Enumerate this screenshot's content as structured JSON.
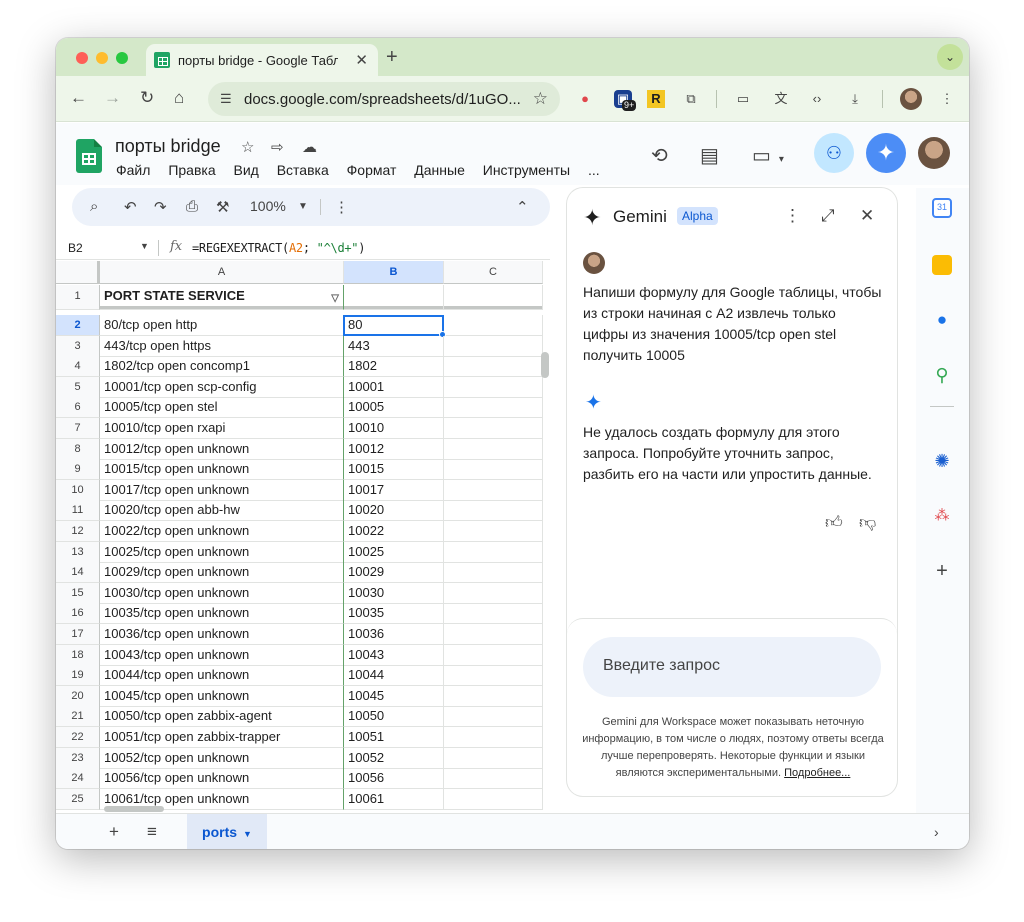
{
  "browser": {
    "tab_title": "порты bridge - Google Табли",
    "tab_close": "✕",
    "new_tab": "+",
    "url": "docs.google.com/spreadsheets/d/1uGO...",
    "ext_badge": "9+",
    "ext_r": "R"
  },
  "sheets": {
    "doc_title": "порты bridge",
    "menu": [
      "Файл",
      "Правка",
      "Вид",
      "Вставка",
      "Формат",
      "Данные",
      "Инструменты",
      "..."
    ],
    "zoom": "100%",
    "name_box": "B2",
    "formula_prefix": "=REGEXEXTRACT(",
    "formula_ref": "A2",
    "formula_sep": "; ",
    "formula_str": "\"^\\d+\"",
    "formula_suffix": ")",
    "columns": [
      "A",
      "B",
      "C"
    ],
    "header_row": {
      "num": "1",
      "a": "PORT STATE SERVICE",
      "b": "",
      "c": ""
    },
    "rows": [
      {
        "num": "2",
        "a": "80/tcp open http",
        "b": "80"
      },
      {
        "num": "3",
        "a": "443/tcp open https",
        "b": "443"
      },
      {
        "num": "4",
        "a": "1802/tcp open concomp1",
        "b": "1802"
      },
      {
        "num": "5",
        "a": "10001/tcp open scp-config",
        "b": "10001"
      },
      {
        "num": "6",
        "a": "10005/tcp open stel",
        "b": "10005"
      },
      {
        "num": "7",
        "a": "10010/tcp open rxapi",
        "b": "10010"
      },
      {
        "num": "8",
        "a": "10012/tcp open unknown",
        "b": "10012"
      },
      {
        "num": "9",
        "a": "10015/tcp open unknown",
        "b": "10015"
      },
      {
        "num": "10",
        "a": "10017/tcp open unknown",
        "b": "10017"
      },
      {
        "num": "11",
        "a": "10020/tcp open abb-hw",
        "b": "10020"
      },
      {
        "num": "12",
        "a": "10022/tcp open unknown",
        "b": "10022"
      },
      {
        "num": "13",
        "a": "10025/tcp open unknown",
        "b": "10025"
      },
      {
        "num": "14",
        "a": "10029/tcp open unknown",
        "b": "10029"
      },
      {
        "num": "15",
        "a": "10030/tcp open unknown",
        "b": "10030"
      },
      {
        "num": "16",
        "a": "10035/tcp open unknown",
        "b": "10035"
      },
      {
        "num": "17",
        "a": "10036/tcp open unknown",
        "b": "10036"
      },
      {
        "num": "18",
        "a": "10043/tcp open unknown",
        "b": "10043"
      },
      {
        "num": "19",
        "a": "10044/tcp open unknown",
        "b": "10044"
      },
      {
        "num": "20",
        "a": "10045/tcp open unknown",
        "b": "10045"
      },
      {
        "num": "21",
        "a": "10050/tcp open zabbix-agent",
        "b": "10050"
      },
      {
        "num": "22",
        "a": "10051/tcp open zabbix-trapper",
        "b": "10051"
      },
      {
        "num": "23",
        "a": "10052/tcp open unknown",
        "b": "10052"
      },
      {
        "num": "24",
        "a": "10056/tcp open unknown",
        "b": "10056"
      },
      {
        "num": "25",
        "a": "10061/tcp open unknown",
        "b": "10061"
      }
    ],
    "sheet_tab": "ports"
  },
  "gemini": {
    "title": "Gemini",
    "badge": "Alpha",
    "user_message": "Напиши формулу для Google таблицы, чтобы из строки начиная с A2 извлечь только цифры  из значения 10005/tcp open stel получить 10005",
    "bot_message": "Не удалось создать формулу для этого запроса. Попробуйте уточнить запрос, разбить его на части или упростить данные.",
    "input_placeholder": "Введите запрос",
    "disclaimer": "Gemini для Workspace может показывать неточную информацию, в том числе о людях, поэтому ответы всегда лучше перепроверять. Некоторые функции и языки являются экспериментальными.",
    "disclaimer_link": "Подробнее..."
  },
  "colors": {
    "tab_strip": "#d4e8c9",
    "accent_blue": "#1a73e8",
    "sheets_green": "#1fa463",
    "selection_blue": "#d3e3fd"
  },
  "icons": [
    "back-icon",
    "forward-icon",
    "reload-icon",
    "home-icon",
    "tune-icon",
    "star-icon",
    "history-icon",
    "comment-icon",
    "meet-icon",
    "share-icon",
    "gemini-icon",
    "search-icon",
    "undo-icon",
    "redo-icon",
    "print-icon",
    "paint-format-icon",
    "more-icon",
    "collapse-icon",
    "fx-icon",
    "filter-icon",
    "expand-icon",
    "close-icon",
    "thumb-up-icon",
    "thumb-down-icon",
    "calendar-icon",
    "keep-icon",
    "contacts-icon",
    "maps-icon",
    "add-icon"
  ]
}
